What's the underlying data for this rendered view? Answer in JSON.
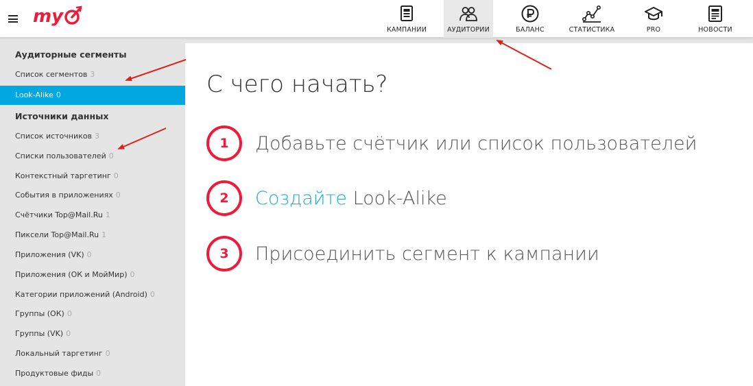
{
  "logo": {
    "text": "my"
  },
  "nav": {
    "tabs": [
      {
        "label": "КАМПАНИИ",
        "icon": "campaigns-icon",
        "active": false
      },
      {
        "label": "АУДИТОРИИ",
        "icon": "audiences-icon",
        "active": true
      },
      {
        "label": "БАЛАНС",
        "icon": "ruble-icon",
        "active": false
      },
      {
        "label": "СТАТИСТИКА",
        "icon": "statistics-icon",
        "active": false
      },
      {
        "label": "PRO",
        "icon": "graduation-cap-icon",
        "active": false
      },
      {
        "label": "НОВОСТИ",
        "icon": "news-icon",
        "active": false
      }
    ]
  },
  "sidebar": {
    "segments_title": "Аудиторные сегменты",
    "segments": [
      {
        "label": "Список сегментов",
        "count": "3",
        "active": false
      },
      {
        "label": "Look-Alike",
        "count": "0",
        "active": true
      }
    ],
    "sources_title": "Источники данных",
    "sources": [
      {
        "label": "Список источников",
        "count": "3"
      },
      {
        "label": "Списки пользователей",
        "count": "0"
      },
      {
        "label": "Контекстный таргетинг",
        "count": "0"
      },
      {
        "label": "События в приложениях",
        "count": "0"
      },
      {
        "label": "Счётчики Top@Mail.Ru",
        "count": "1"
      },
      {
        "label": "Пиксели Top@Mail.Ru",
        "count": "1"
      },
      {
        "label": "Приложения (VK)",
        "count": "0"
      },
      {
        "label": "Приложения (ОК и МойМир)",
        "count": "0"
      },
      {
        "label": "Категории приложений (Android)",
        "count": "0"
      },
      {
        "label": "Группы (ОК)",
        "count": "0"
      },
      {
        "label": "Группы (VK)",
        "count": "0"
      },
      {
        "label": "Локальный таргетинг",
        "count": "0"
      },
      {
        "label": "Продуктовые фиды",
        "count": "0"
      }
    ]
  },
  "main": {
    "title": "С чего начать?",
    "steps": [
      {
        "num": "1",
        "text": "Добавьте счётчик или список пользователей"
      },
      {
        "num": "2",
        "link": "Создайте",
        "text": " Look-Alike"
      },
      {
        "num": "3",
        "text": "Присоединить сегмент к кампании"
      }
    ]
  },
  "colors": {
    "accent": "#00a7e1",
    "link": "#1fa9de",
    "brand_red": "#ed1c3c",
    "sidebar_bg": "#e5e5e5",
    "annotation": "#e0201a"
  }
}
